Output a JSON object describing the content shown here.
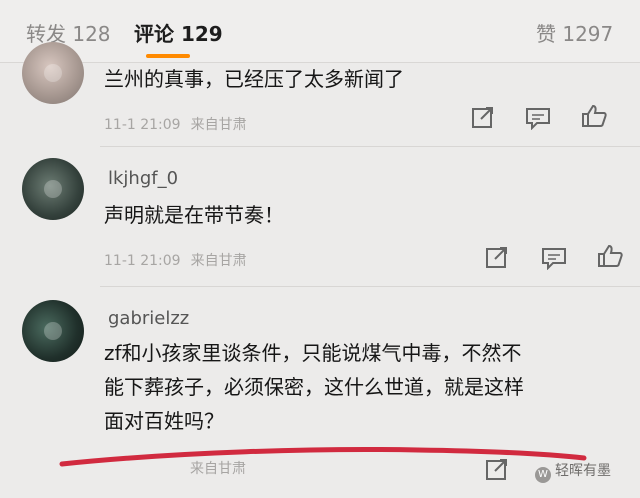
{
  "tabs": {
    "repost": "转发 128",
    "comments": "评论 129",
    "likes": "赞 1297"
  },
  "icons": {
    "share": "share-icon",
    "comment": "comment-icon",
    "like": "thumbs-up-icon"
  },
  "comments": [
    {
      "text": "兰州的真事，已经压了太多新闻了",
      "time": "11-1 21:09",
      "location": "来自甘肃"
    },
    {
      "username": "lkjhgf_0",
      "text": "声明就是在带节奏！",
      "time": "11-1 21:09",
      "location": "来自甘肃"
    },
    {
      "username": "gabrielzz",
      "text_lines": [
        "zf和小孩家里谈条件，只能说煤气中毒，不然不",
        "能下葬孩子，必须保密，这什么世道，就是这样",
        "面对百姓吗？"
      ],
      "location": "来自甘肃"
    }
  ],
  "watermark": "轻晖有墨",
  "colors": {
    "accent": "#ff8a00",
    "annotation": "#d12a3f"
  }
}
